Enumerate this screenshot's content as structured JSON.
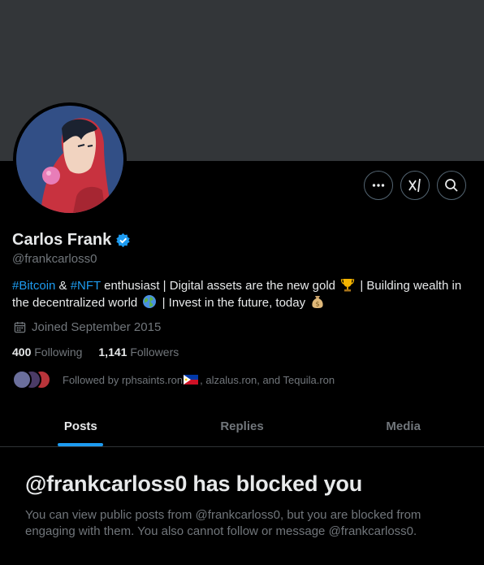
{
  "profile": {
    "name": "Carlos Frank",
    "handle": "@frankcarloss0",
    "bio": {
      "tag1": "#Bitcoin",
      "amp": " & ",
      "tag2": "#NFT",
      "text1": " enthusiast | Digital assets are the new gold ",
      "text2": " | Building wealth in the decentralized world ",
      "text3": " | Invest in the future, today "
    },
    "joined": "Joined September 2015",
    "following_count": "400",
    "following_label": "Following",
    "followers_count": "1,141",
    "followers_label": "Followers",
    "followed_by_prefix": "Followed by rphsaints.ron",
    "followed_by_suffix": ", alzalus.ron, and Tequila.ron"
  },
  "actions": {
    "more_icon": "more-horizontal-icon",
    "grok_icon": "grok-icon",
    "search_icon": "search-icon"
  },
  "tabs": [
    {
      "label": "Posts",
      "active": true
    },
    {
      "label": "Replies",
      "active": false
    },
    {
      "label": "Media",
      "active": false
    }
  ],
  "blocked": {
    "title": "@frankcarloss0 has blocked you",
    "body": "You can view public posts from @frankcarloss0, but you are blocked from engaging with them. You also cannot follow or message @frankcarloss0."
  },
  "colors": {
    "background": "#000000",
    "banner": "#333639",
    "accent": "#1d9bf0",
    "muted": "#71767b",
    "text": "#e7e9ea"
  }
}
